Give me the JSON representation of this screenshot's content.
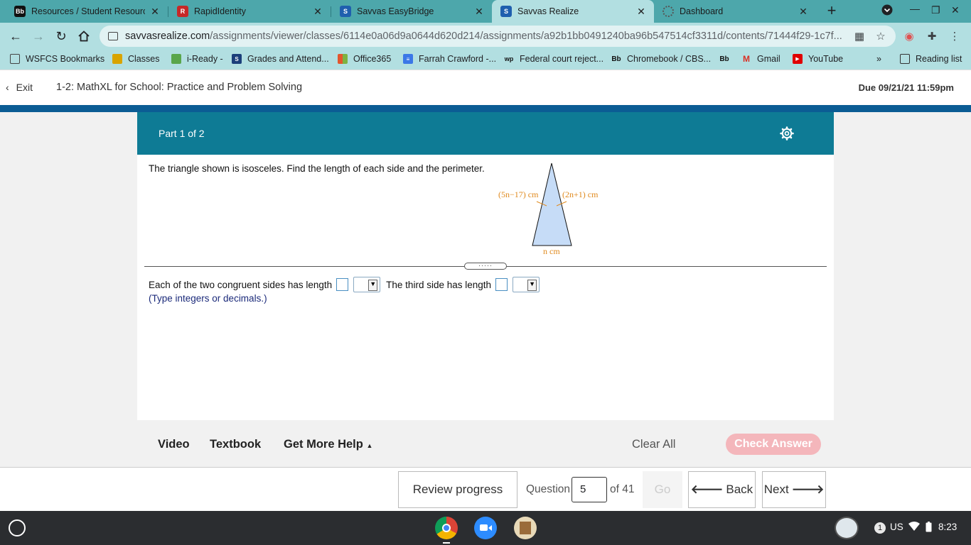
{
  "browser": {
    "tabs": [
      {
        "title": "Resources / Student Resources",
        "icon": "blackboard-icon",
        "active": false
      },
      {
        "title": "RapidIdentity",
        "icon": "rapididentity-icon",
        "active": false
      },
      {
        "title": "Savvas EasyBridge",
        "icon": "savvas-icon",
        "active": false
      },
      {
        "title": "Savvas Realize",
        "icon": "savvas-icon",
        "active": true
      },
      {
        "title": "Dashboard",
        "icon": "loading-icon",
        "active": false
      }
    ],
    "url_host": "savvasrealize.com",
    "url_path": "/assignments/viewer/classes/6114e0a06d9a0644d620d214/assignments/a92b1bb0491240ba96b547514cf3311d/contents/71444f29-1c7f...",
    "bookmarks": [
      {
        "label": "WSFCS Bookmarks",
        "icon": "folder-icon",
        "color": "#444444"
      },
      {
        "label": "Classes",
        "icon": "classes-icon",
        "color": "#d9a400"
      },
      {
        "label": "i-Ready -",
        "icon": "iready-icon",
        "color": "#5aa64b"
      },
      {
        "label": "Grades and Attend...",
        "icon": "sis-icon",
        "color": "#1b3f7a"
      },
      {
        "label": "Office365",
        "icon": "office-icon",
        "color": "#e3562d"
      },
      {
        "label": "Farrah Crawford -...",
        "icon": "docs-icon",
        "color": "#3b78e7"
      },
      {
        "label": "Federal court reject...",
        "icon": "news-icon",
        "color": "#111111"
      },
      {
        "label": "Chromebook / CBS...",
        "icon": "blackboard-icon",
        "color": "#111111"
      },
      {
        "label": "",
        "icon": "blackboard-icon",
        "color": "#111111"
      },
      {
        "label": "Gmail",
        "icon": "gmail-icon",
        "color": "#d93025"
      },
      {
        "label": "YouTube",
        "icon": "youtube-icon",
        "color": "#e00000"
      }
    ],
    "more_bookmarks": "»",
    "reading_list": "Reading list"
  },
  "header": {
    "exit_label": "Exit",
    "assignment_title": "1-2: MathXL for School: Practice and Problem Solving",
    "due": "Due 09/21/21 11:59pm"
  },
  "card": {
    "part": "Part 1 of 2",
    "question": "The triangle shown is isosceles. Find the length of each side and the perimeter.",
    "triangle": {
      "left_label": "(5n−17) cm",
      "right_label": "(2n+1) cm",
      "base_label": "n cm",
      "fill": "#c6dcf7",
      "label_color": "#e08a1e"
    },
    "handle": "·····",
    "answer_text_1": "Each of the two congruent sides has length",
    "answer_text_2": "The third side has length",
    "hint": "(Type integers or decimals.)"
  },
  "helpbar": {
    "video": "Video",
    "textbook": "Textbook",
    "more_help": "Get More Help",
    "clear_all": "Clear All",
    "check_answer": "Check Answer"
  },
  "footer": {
    "review": "Review progress",
    "question_label": "Question",
    "question_number": "5",
    "of_total": "of 41",
    "go": "Go",
    "back": "Back",
    "next": "Next"
  },
  "shelf": {
    "notification_count": "1",
    "locale": "US",
    "time": "8:23"
  },
  "colors": {
    "card_header": "#0e7b95",
    "brand_bar": "#0b5c94",
    "check_answer": "#f4b6bb",
    "browser_frame": "#4da7ab"
  }
}
